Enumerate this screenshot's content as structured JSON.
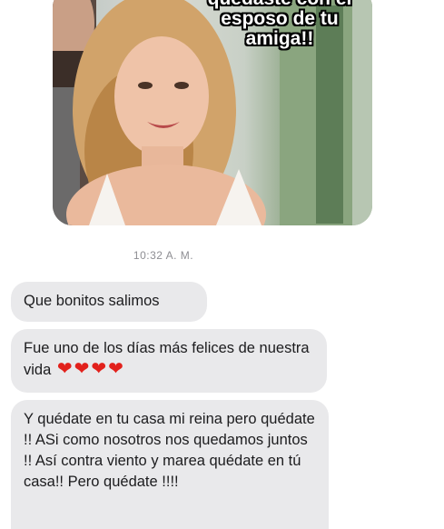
{
  "photo": {
    "caption_lines": [
      "quedaste con el",
      "esposo de tu",
      "amiga!!"
    ]
  },
  "thread": {
    "timestamp": "10:32 A. M.",
    "messages": [
      {
        "text": "Que bonitos salimos"
      },
      {
        "text": "Fue uno de los días más felices de nuestra vida",
        "emoji": [
          "❤",
          "❤",
          "❤",
          "❤"
        ]
      },
      {
        "text": "Y quédate en tu casa mi reina pero quédate !! ASi como nosotros nos quedamos juntos !! Así contra viento y marea quédate en tú casa!! Pero quédate !!!!"
      }
    ]
  },
  "colors": {
    "incoming_bubble": "#e9e9eb",
    "timestamp_text": "#8e8e93",
    "heart": "#e2211c"
  }
}
